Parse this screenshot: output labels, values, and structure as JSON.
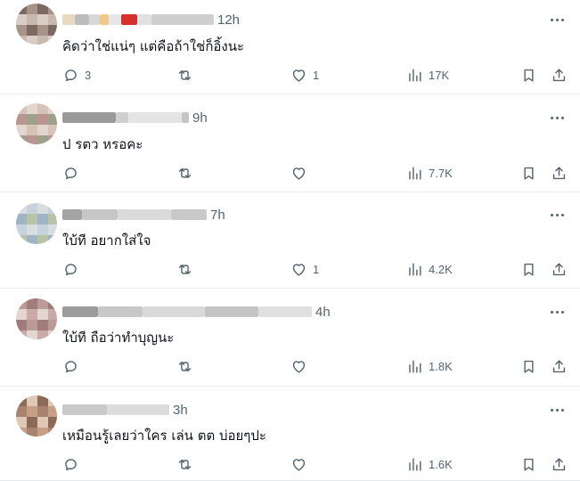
{
  "posts": [
    {
      "text": "คิดว่าใช่แน่ๆ แต่คือถ้าใช่ก็อิ้งนะ",
      "time": "12h",
      "replies": "3",
      "reposts": "",
      "likes": "1",
      "views": "17K",
      "avatar_colors": [
        "#7a6a62",
        "#c9b8ae",
        "#a89388",
        "#d9cdc6"
      ]
    },
    {
      "text": "ป รตว หรอคะ",
      "time": "9h",
      "replies": "",
      "reposts": "",
      "likes": "",
      "views": "7.7K",
      "avatar_colors": [
        "#b89590",
        "#d6c3b8",
        "#9fa08a",
        "#e2d6cf"
      ]
    },
    {
      "text": "ใบ้ที อยากใส่ใจ",
      "time": "7h",
      "replies": "",
      "reposts": "",
      "likes": "1",
      "views": "4.2K",
      "avatar_colors": [
        "#c6d2dc",
        "#9fb5c6",
        "#d8dde0",
        "#b7c4a8"
      ]
    },
    {
      "text": "ใบ้ที ถือว่าทำบุญนะ",
      "time": "4h",
      "replies": "",
      "reposts": "",
      "likes": "",
      "views": "1.8K",
      "avatar_colors": [
        "#c9aaa6",
        "#a07d7a",
        "#e3d5d2",
        "#bb9b98"
      ]
    },
    {
      "text": "เหมือนรู้เลยว่าใคร เล่น ตต บ่อยๆปะ",
      "time": "3h",
      "replies": "",
      "reposts": "",
      "likes": "",
      "views": "1.6K",
      "avatar_colors": [
        "#8c6a58",
        "#c59f86",
        "#e0c7b6",
        "#a88470"
      ]
    }
  ],
  "icons": {
    "reply": "reply-icon",
    "repost": "repost-icon",
    "like": "heart-icon",
    "views": "views-chart-icon",
    "bookmark": "bookmark-icon",
    "share": "share-icon",
    "more": "more-dots-icon"
  },
  "colors": {
    "text": "#0f1419",
    "secondary": "#536471",
    "divider": "#e6ecf0"
  }
}
